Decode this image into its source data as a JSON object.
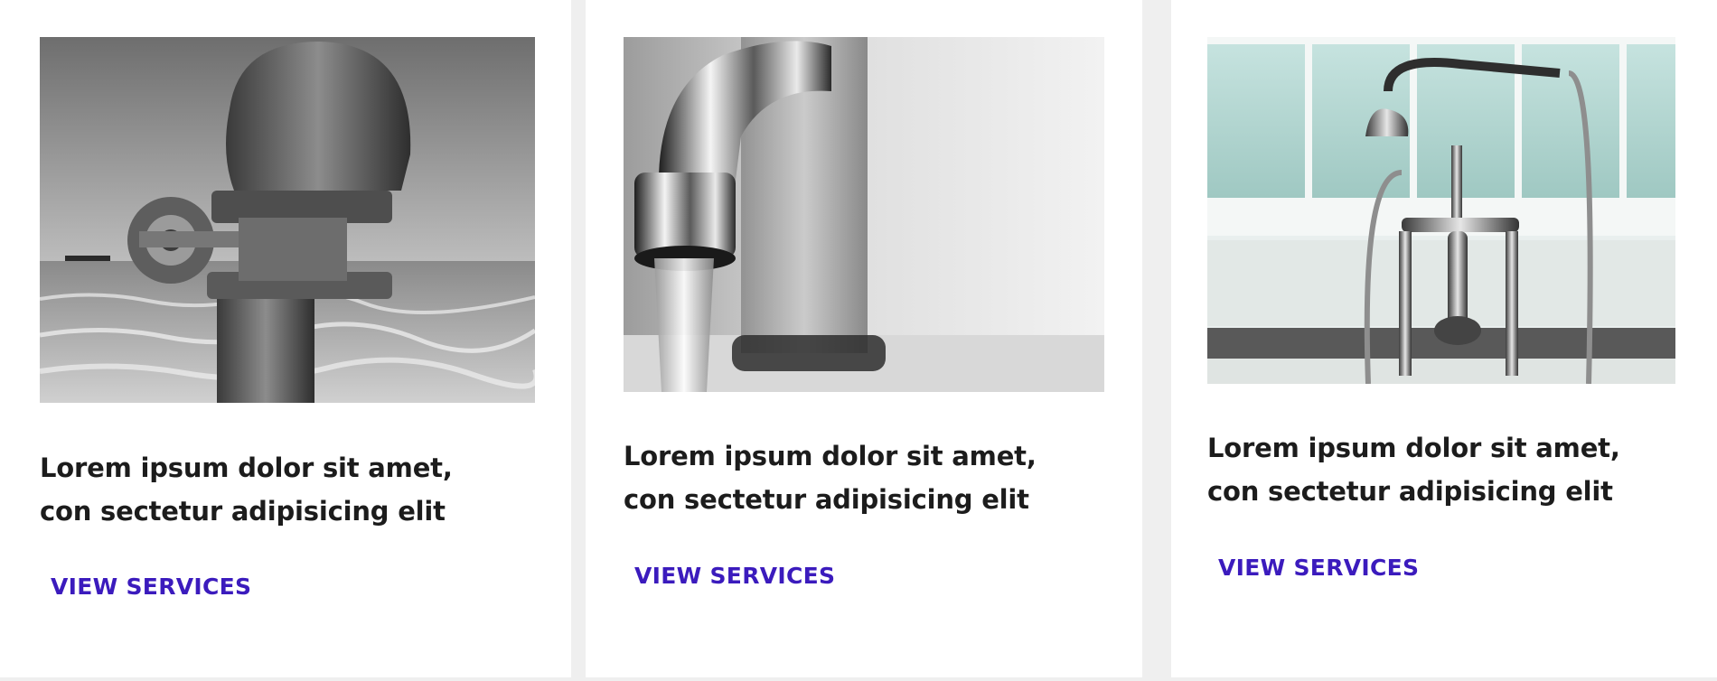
{
  "cards": [
    {
      "image_name": "rusty-pipe-valve-photo",
      "title_line_1": "Lorem ipsum dolor sit amet,",
      "title_line_2": "con sectetur adipisicing elit",
      "link_label": "VIEW SERVICES"
    },
    {
      "image_name": "chrome-faucet-water-photo",
      "title_line_1": "Lorem ipsum dolor sit amet,",
      "title_line_2": "con sectetur adipisicing elit",
      "link_label": "VIEW SERVICES"
    },
    {
      "image_name": "bath-shower-mixer-photo",
      "title_line_1": "Lorem ipsum dolor sit amet,",
      "title_line_2": "con sectetur adipisicing elit",
      "link_label": "VIEW SERVICES"
    }
  ],
  "colors": {
    "page_background": "#efefef",
    "card_background": "#ffffff",
    "title_text": "#1c1c1c",
    "link_text": "#3b1bbd"
  }
}
